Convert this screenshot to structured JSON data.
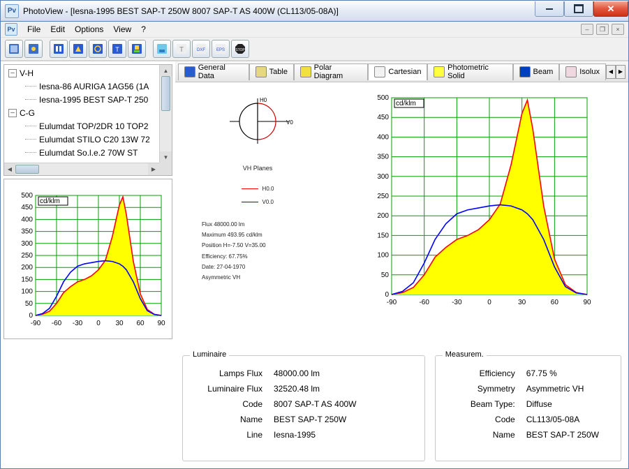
{
  "window": {
    "title": "PhotoView - [Iesna-1995 BEST SAP-T 250W 8007 SAP-T AS 400W (CL113/05-08A)]",
    "app_short": "Pv"
  },
  "menu": {
    "file": "File",
    "edit": "Edit",
    "options": "Options",
    "view": "View",
    "help": "?"
  },
  "tree": {
    "groups": [
      {
        "label": "V-H",
        "expanded": true,
        "children": [
          "Iesna-86 AURIGA 1AG56 (1A",
          "Iesna-1995 BEST SAP-T 250"
        ]
      },
      {
        "label": "C-G",
        "expanded": true,
        "children": [
          "Eulumdat TOP/2DR 10 TOP2",
          "Eulumdat STILO C20 13W 72",
          "Eulumdat So.l.e.2  70W ST"
        ]
      }
    ]
  },
  "tabs": {
    "items": [
      {
        "label": "General Data",
        "icon_bg": "#2a5bd0"
      },
      {
        "label": "Table",
        "icon_bg": "#e6d880"
      },
      {
        "label": "Polar Diagram",
        "icon_bg": "#f2e040"
      },
      {
        "label": "Cartesian",
        "icon_bg": "#f2f2f2",
        "selected": true
      },
      {
        "label": "Photometric Solid",
        "icon_bg": "#ffff40"
      },
      {
        "label": "Beam",
        "icon_bg": "#0040c0"
      },
      {
        "label": "Isolux",
        "icon_bg": "#f0d8e0"
      }
    ]
  },
  "diagram": {
    "planes_label": "VH Planes",
    "h0": "H0",
    "v0": "V0",
    "legend": [
      {
        "label": "H0.0",
        "color": "#f00"
      },
      {
        "label": "V0.0",
        "color": "#00f"
      }
    ],
    "info": [
      "Flux 48000.00  lm",
      "Maximum 493.95 cd/klm",
      "Position H=-7.50 V=35.00",
      "Efficiency:  67.75%",
      "Date: 27-04-1970",
      "Asymmetric VH"
    ]
  },
  "luminaire": {
    "title": "Luminaire",
    "rows": [
      [
        "Lamps Flux",
        "48000.00 lm"
      ],
      [
        "Luminaire Flux",
        "32520.48 lm"
      ],
      [
        "Code",
        "8007 SAP-T AS 400W"
      ],
      [
        "Name",
        "BEST SAP-T 250W"
      ],
      [
        "Line",
        "Iesna-1995"
      ]
    ]
  },
  "measurement": {
    "title": "Measurem.",
    "rows": [
      [
        "Efficiency",
        "67.75 %"
      ],
      [
        "Symmetry",
        "Asymmetric VH"
      ],
      [
        "Beam Type:",
        "Diffuse"
      ],
      [
        "Code",
        "CL113/05-08A"
      ],
      [
        "Name",
        "BEST SAP-T 250W"
      ]
    ]
  },
  "chart_data": {
    "type": "line",
    "title": "cd/klm",
    "xlabel": "",
    "ylabel": "cd/klm",
    "xlim": [
      -90,
      90
    ],
    "ylim": [
      0,
      500
    ],
    "x_ticks": [
      -90,
      -60,
      -30,
      0,
      30,
      60,
      90
    ],
    "y_ticks": [
      0,
      50,
      100,
      150,
      200,
      250,
      300,
      350,
      400,
      450,
      500
    ],
    "x": [
      -90,
      -80,
      -70,
      -60,
      -50,
      -40,
      -30,
      -20,
      -10,
      0,
      10,
      20,
      30,
      35,
      40,
      50,
      60,
      70,
      80,
      90
    ],
    "series": [
      {
        "name": "H0.0",
        "color": "#ff0000",
        "fill": "#ffff00",
        "values": [
          0,
          5,
          18,
          50,
          95,
          120,
          140,
          150,
          165,
          190,
          230,
          330,
          460,
          494,
          420,
          225,
          90,
          25,
          5,
          0
        ]
      },
      {
        "name": "V0.0",
        "color": "#0000ff",
        "values": [
          0,
          8,
          30,
          80,
          140,
          180,
          205,
          215,
          220,
          225,
          228,
          225,
          215,
          205,
          190,
          140,
          70,
          20,
          4,
          0
        ]
      }
    ]
  }
}
